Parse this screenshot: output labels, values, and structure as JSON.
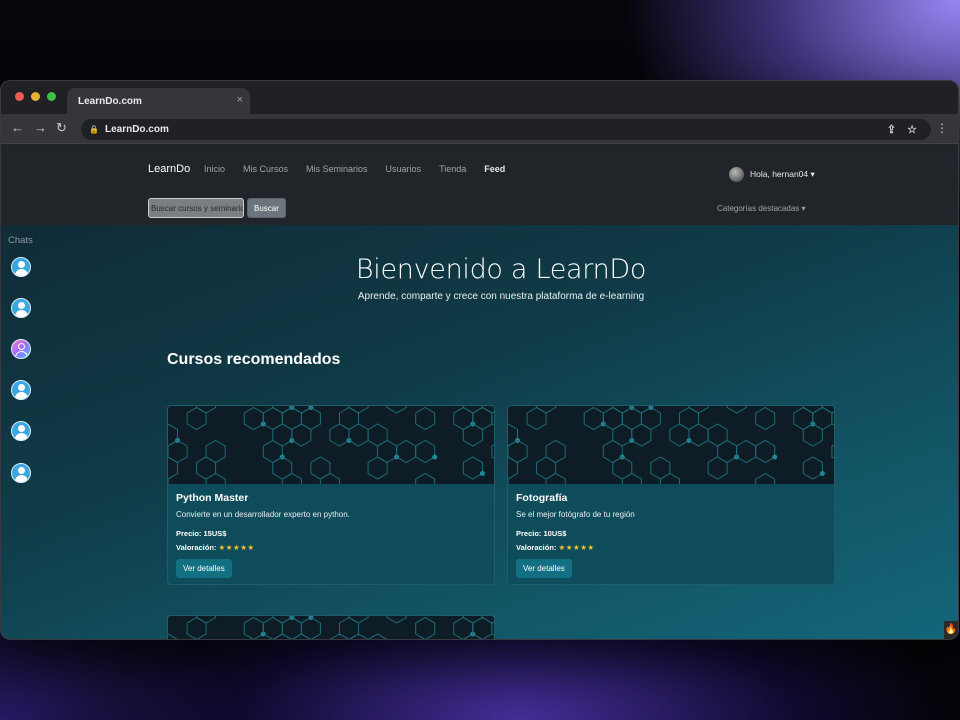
{
  "browser": {
    "tab_title": "LearnDo.com",
    "tab_close": "×",
    "url": "LearnDo.com",
    "back": "←",
    "forward": "→",
    "reload": "↻",
    "lock": "🔒",
    "share": "⇪",
    "bookmark": "☆",
    "menu": "⋮"
  },
  "navbar": {
    "brand": "LearnDo",
    "links": [
      "Inicio",
      "Mis Cursos",
      "Mis Seminarios",
      "Usuarios",
      "Tienda",
      "Feed"
    ],
    "user_greeting": "Hola, hernan04 ▾",
    "search_placeholder": "Buscar cursos y seminarios",
    "search_button": "Buscar",
    "categories": "Categorías destacadas ▾"
  },
  "chats": {
    "title": "Chats",
    "count": 6
  },
  "hero": {
    "title": "Bienvenido a LearnDo",
    "subtitle": "Aprende, comparte y crece con nuestra plataforma de e-learning"
  },
  "section": {
    "title": "Cursos recomendados"
  },
  "courses": [
    {
      "title": "Python Master",
      "description": "Convierte en un desarrollador experto en python.",
      "price_label": "Precio: 15US$",
      "rating_label": "Valoración:",
      "stars": "★★★★★",
      "button": "Ver detalles"
    },
    {
      "title": "Fotografía",
      "description": "Se el mejor fotógrafo de tu región",
      "price_label": "Precio: 10US$",
      "rating_label": "Valoración:",
      "stars": "★★★★★",
      "button": "Ver detalles"
    }
  ],
  "colors": {
    "navbar_bg": "#212529",
    "page_gradient_start": "#0f2732",
    "page_gradient_end": "#13667a",
    "card_bg": "#0f4c5b",
    "button_bg": "#137083",
    "star_color": "#f0c22e"
  },
  "icons": [
    "chevron-left-icon",
    "chevron-right-icon",
    "reload-icon",
    "lock-icon",
    "share-icon",
    "star-bookmark-icon",
    "kebab-menu-icon",
    "user-avatar-icon",
    "fire-icon"
  ]
}
